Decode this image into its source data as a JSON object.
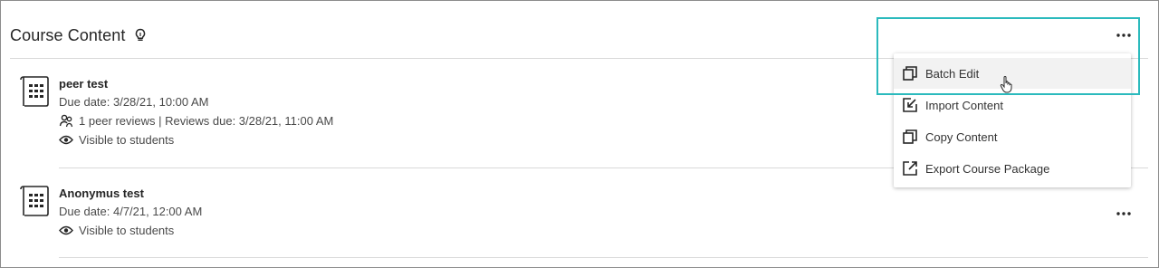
{
  "header": {
    "title": "Course Content"
  },
  "items": [
    {
      "title": "peer test",
      "due": "Due date: 3/28/21, 10:00 AM",
      "reviews": "1 peer reviews | Reviews due: 3/28/21, 11:00 AM",
      "visibility": "Visible to students"
    },
    {
      "title": "Anonymus test",
      "due": "Due date: 4/7/21, 12:00 AM",
      "visibility": "Visible to students"
    }
  ],
  "menu": {
    "items": [
      {
        "label": "Batch Edit",
        "icon": "batch-edit-icon"
      },
      {
        "label": "Import Content",
        "icon": "import-icon"
      },
      {
        "label": "Copy Content",
        "icon": "copy-icon"
      },
      {
        "label": "Export Course Package",
        "icon": "export-icon"
      }
    ]
  },
  "colors": {
    "highlight": "#2bbabd",
    "text": "#262626",
    "divider": "#d9d9d9"
  }
}
